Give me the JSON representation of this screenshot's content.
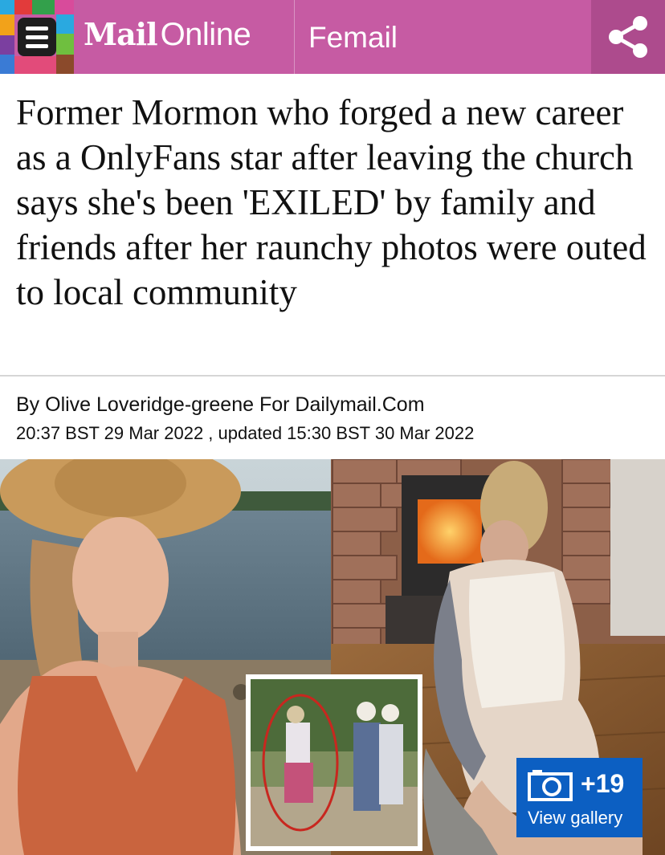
{
  "header": {
    "brand_mail": "Mail",
    "brand_online": "Online",
    "section": "Femail",
    "colors": {
      "bar": "#c65ba3",
      "share_bg": "#ad4b8d"
    }
  },
  "article": {
    "headline": "Former Mormon who forged a new career as a OnlyFans star after leaving the church says she's been 'EXILED' by family and friends after her raunchy photos were outed to local community",
    "byline": "By Olive Loveridge-greene For Dailymail.Com",
    "dateline": "20:37 BST 29 Mar 2022 , updated 15:30 BST 30 Mar 2022"
  },
  "gallery": {
    "count": "+19",
    "label": "View gallery",
    "color": "#0c5fc2"
  },
  "icons": [
    "menu-icon",
    "share-icon",
    "camera-icon"
  ]
}
